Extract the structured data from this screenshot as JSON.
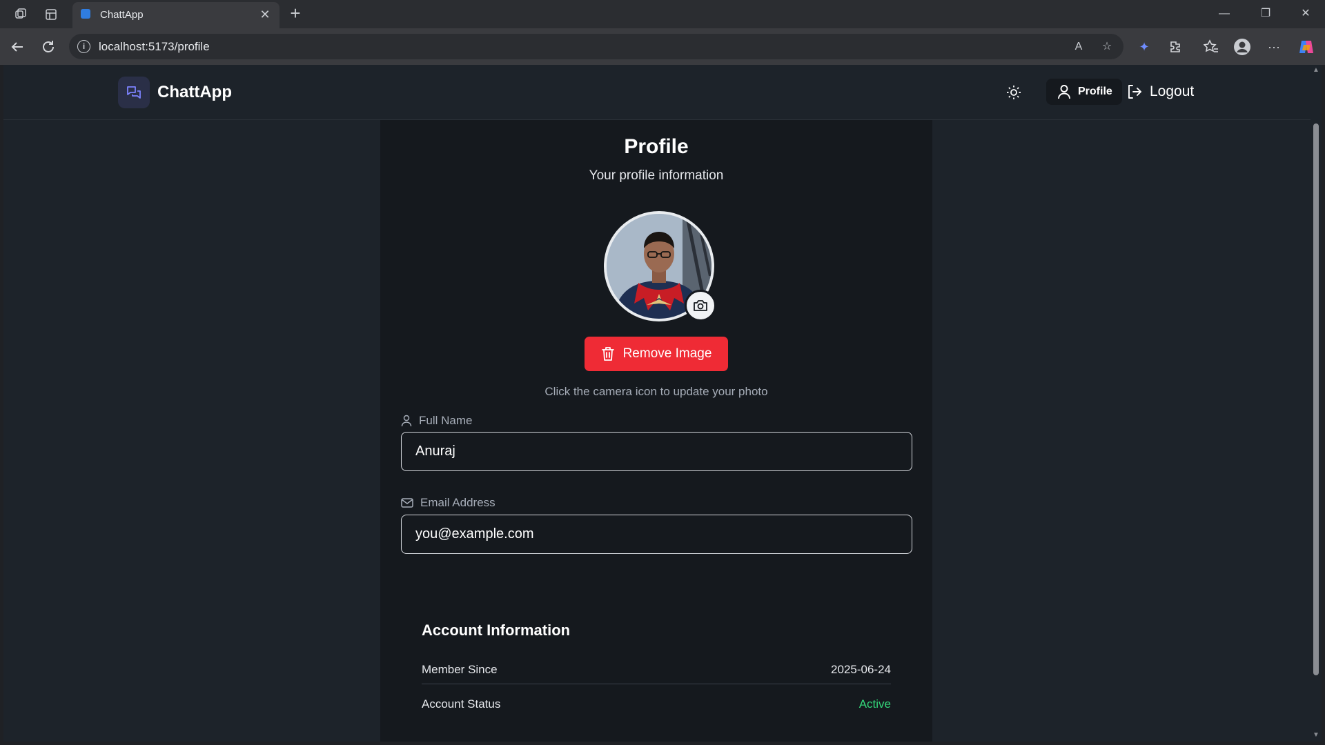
{
  "browser": {
    "tab_title": "ChattApp",
    "url": "localhost:5173/profile"
  },
  "header": {
    "brand": "ChattApp",
    "profile_label": "Profile",
    "logout_label": "Logout"
  },
  "profile": {
    "title": "Profile",
    "subtitle": "Your profile information",
    "remove_image_label": "Remove Image",
    "hint": "Click the camera icon to update your photo",
    "full_name_label": "Full Name",
    "full_name_value": "Anuraj",
    "email_label": "Email Address",
    "email_value": "you@example.com"
  },
  "account": {
    "title": "Account Information",
    "rows": [
      {
        "label": "Member Since",
        "value": "2025-06-24"
      },
      {
        "label": "Account Status",
        "value": "Active"
      }
    ]
  },
  "colors": {
    "accent_red": "#ef2b35",
    "status_green": "#34d77a",
    "logo_accent": "#7c83ff"
  }
}
